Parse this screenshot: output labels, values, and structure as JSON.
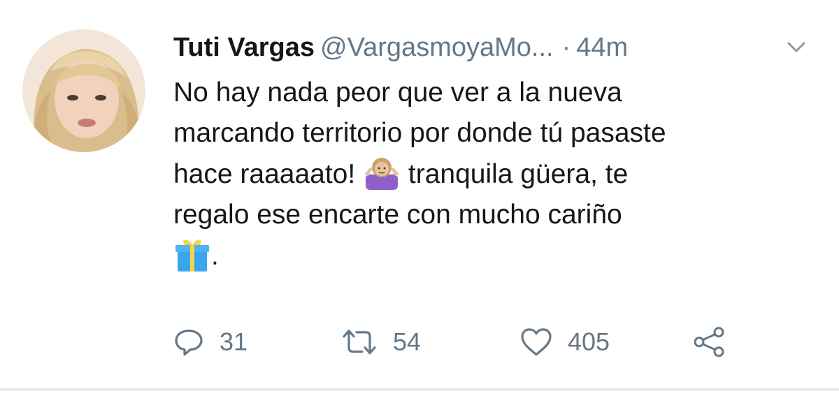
{
  "tweet": {
    "author_name": "Tuti Vargas",
    "handle": "@VargasmoyaMo...",
    "separator": "·",
    "time": "44m",
    "lines": [
      "No hay nada peor que ver a la nueva",
      "marcando territorio por donde tú pasaste",
      "hace raaaaato!",
      "tranquila güera, te",
      "regalo ese encarte con mucho cariño",
      "."
    ],
    "emojis": [
      "person-shrugging-emoji",
      "gift-emoji"
    ]
  },
  "actions": {
    "reply_count": "31",
    "retweet_count": "54",
    "like_count": "405"
  },
  "icons": [
    "reply-icon",
    "retweet-icon",
    "like-icon",
    "share-icon",
    "chevron-down-icon"
  ],
  "colors": {
    "text": "#14171a",
    "secondary": "#657786",
    "border": "#e6ecf0"
  }
}
